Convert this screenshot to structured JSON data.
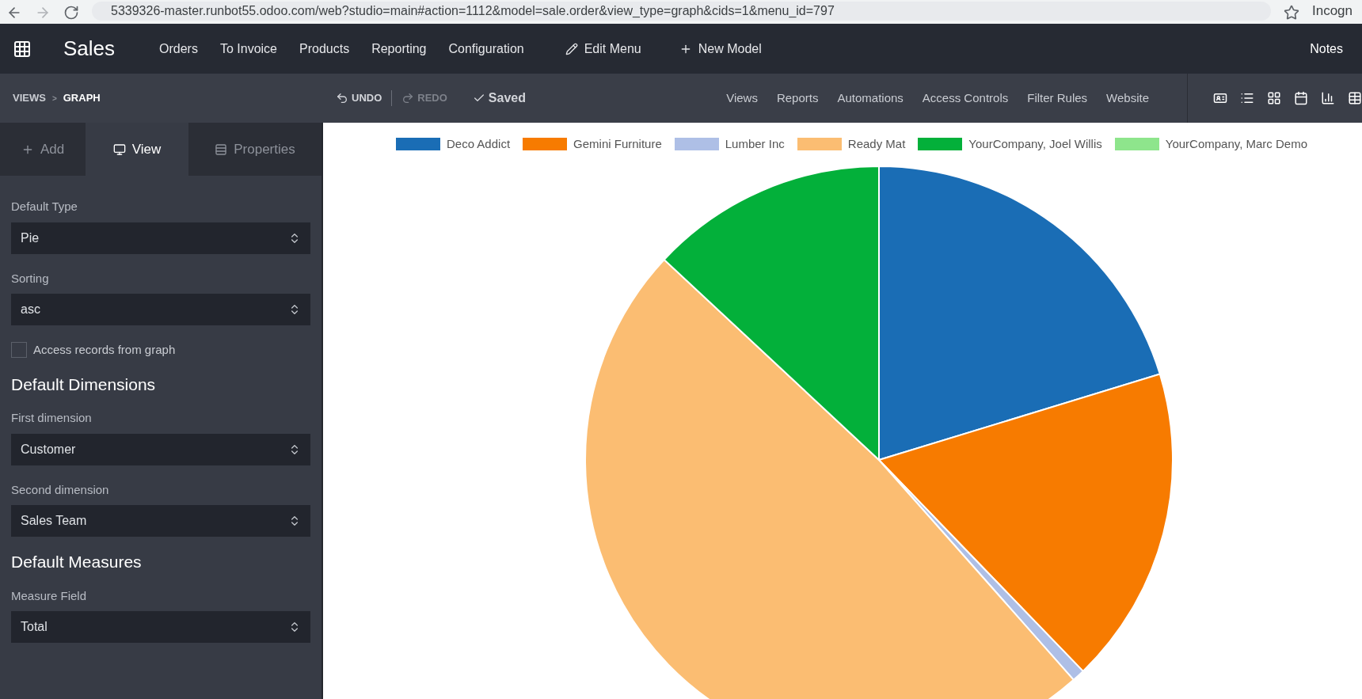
{
  "browser": {
    "url": "5339326-master.runbot55.odoo.com/web?studio=main#action=1112&model=sale.order&view_type=graph&cids=1&menu_id=797",
    "profile": "Incogn"
  },
  "navbar": {
    "app": "Sales",
    "menu": [
      "Orders",
      "To Invoice",
      "Products",
      "Reporting",
      "Configuration"
    ],
    "edit_menu": "Edit Menu",
    "new_model": "New Model",
    "notes": "Notes"
  },
  "toolbar": {
    "breadcrumb": [
      "VIEWS",
      "GRAPH"
    ],
    "separator": ">",
    "undo": "UNDO",
    "redo": "REDO",
    "saved": "Saved",
    "links": [
      "Views",
      "Reports",
      "Automations",
      "Access Controls",
      "Filter Rules",
      "Website"
    ]
  },
  "sidebar": {
    "tabs": [
      {
        "label": "Add",
        "selected": false
      },
      {
        "label": "View",
        "selected": true
      },
      {
        "label": "Properties",
        "selected": false
      }
    ],
    "fields": [
      {
        "kind": "select",
        "label": "Default Type",
        "value": "Pie"
      },
      {
        "kind": "select",
        "label": "Sorting",
        "value": "asc"
      },
      {
        "kind": "checkbox",
        "label": "Access records from graph",
        "checked": false
      },
      {
        "kind": "heading",
        "label": "Default Dimensions"
      },
      {
        "kind": "select",
        "label": "First dimension",
        "value": "Customer"
      },
      {
        "kind": "select",
        "label": "Second dimension",
        "value": "Sales Team"
      },
      {
        "kind": "heading",
        "label": "Default Measures"
      },
      {
        "kind": "select",
        "label": "Measure Field",
        "value": "Total"
      }
    ]
  },
  "legend": [
    {
      "label": "Deco Addict",
      "color": "#1a6db5"
    },
    {
      "label": "Gemini Furniture",
      "color": "#f77b00"
    },
    {
      "label": "Lumber Inc",
      "color": "#aebfe6"
    },
    {
      "label": "Ready Mat",
      "color": "#fbbd72"
    },
    {
      "label": "YourCompany, Joel Willis",
      "color": "#03b03a"
    },
    {
      "label": "YourCompany, Marc Demo",
      "color": "#8ee58c"
    }
  ]
}
